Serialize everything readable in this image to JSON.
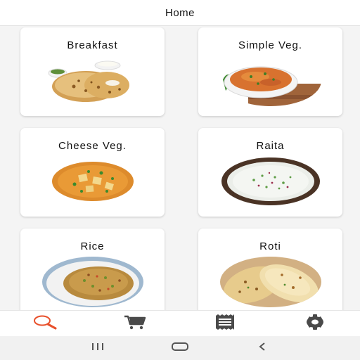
{
  "header": {
    "title": "Home"
  },
  "categories": [
    {
      "label": "Breakfast"
    },
    {
      "label": "Simple Veg."
    },
    {
      "label": "Cheese Veg."
    },
    {
      "label": "Raita"
    },
    {
      "label": "Rice"
    },
    {
      "label": "Roti"
    }
  ],
  "bottom_nav": {
    "items": [
      {
        "icon": "search-icon",
        "active": true
      },
      {
        "icon": "cart-icon",
        "active": false
      },
      {
        "icon": "receipt-icon",
        "active": false
      },
      {
        "icon": "gear-icon",
        "active": false
      }
    ],
    "active_color": "#e8502b",
    "inactive_color": "#4a4a4a"
  },
  "system_nav": {
    "icons": [
      "recents-icon",
      "home-icon",
      "back-icon"
    ]
  }
}
